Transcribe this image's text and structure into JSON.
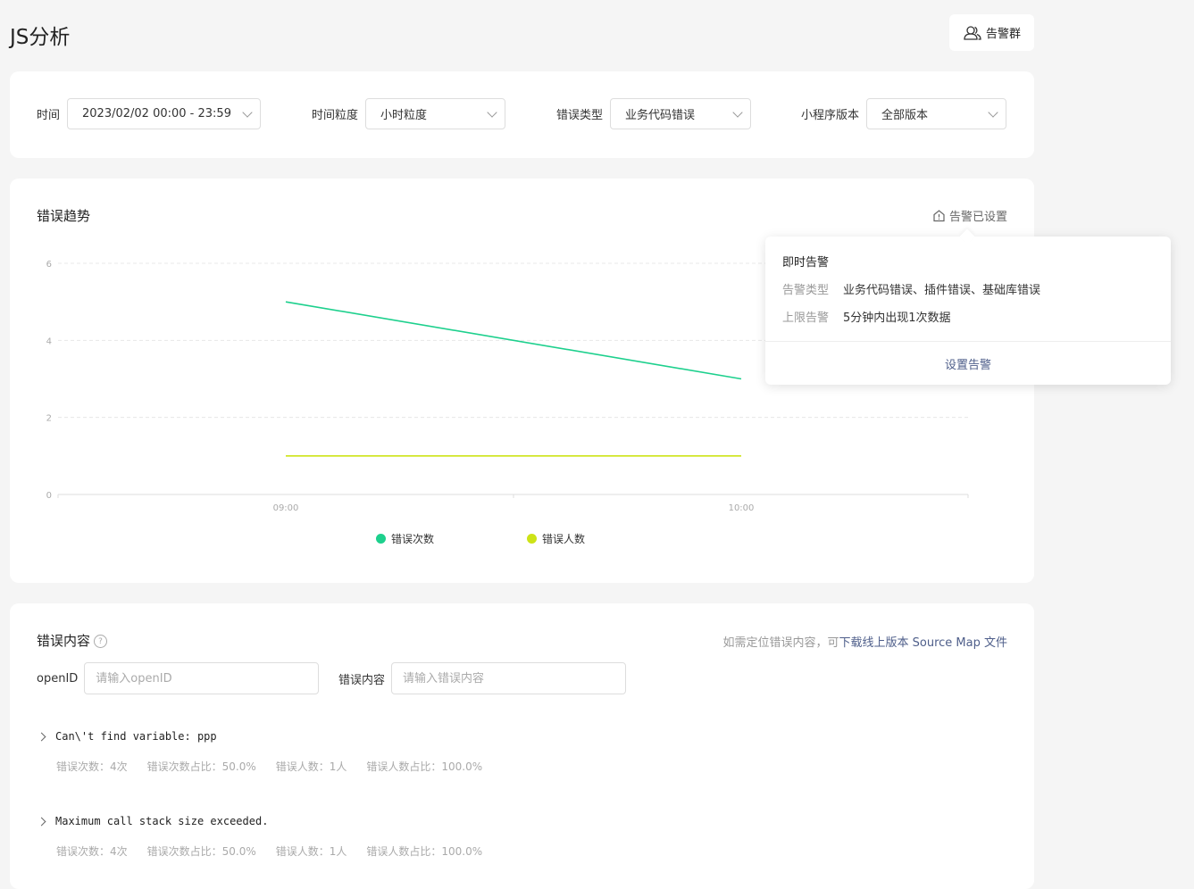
{
  "page": {
    "title": "JS分析"
  },
  "header": {
    "alert_group_label": "告警群",
    "alert_group_icon": "user-group-icon"
  },
  "filters": [
    {
      "label": "时间",
      "value": "2023/02/02 00:00 - 23:59"
    },
    {
      "label": "时间粒度",
      "value": "小时粒度"
    },
    {
      "label": "错误类型",
      "value": "业务代码错误"
    },
    {
      "label": "小程序版本",
      "value": "全部版本"
    }
  ],
  "trend": {
    "title": "错误趋势",
    "alert_status": "告警已设置",
    "alert_icon": "home-alert-icon"
  },
  "chart_data": {
    "type": "line",
    "categories": [
      "09:00",
      "10:00"
    ],
    "ylim": [
      0,
      6
    ],
    "yticks": [
      0,
      2,
      4,
      6
    ],
    "grid": true,
    "legend_position": "bottom",
    "series": [
      {
        "name": "错误次数",
        "values": [
          5,
          3
        ],
        "color": "#1dd08d"
      },
      {
        "name": "错误人数",
        "values": [
          1,
          1
        ],
        "color": "#cde317"
      }
    ]
  },
  "popover": {
    "title": "即时告警",
    "rows": [
      {
        "key": "告警类型",
        "value": "业务代码错误、插件错误、基础库错误"
      },
      {
        "key": "上限告警",
        "value": "5分钟内出现1次数据"
      }
    ],
    "action": "设置告警"
  },
  "errors": {
    "title": "错误内容",
    "help_icon": "question-circle-icon",
    "hint_prefix": "如需定位错误内容，可",
    "hint_link": "下载线上版本 Source Map 文件",
    "openid_label": "openID",
    "openid_placeholder": "请输入openID",
    "content_label": "错误内容",
    "content_placeholder": "请输入错误内容",
    "items": [
      {
        "message": "Can\\'t find variable: ppp",
        "count": "错误次数：4次",
        "count_ratio": "错误次数占比：50.0%",
        "users": "错误人数：1人",
        "users_ratio": "错误人数占比：100.0%"
      },
      {
        "message": "Maximum call stack size exceeded.",
        "count": "错误次数：4次",
        "count_ratio": "错误次数占比：50.0%",
        "users": "错误人数：1人",
        "users_ratio": "错误人数占比：100.0%"
      }
    ]
  }
}
